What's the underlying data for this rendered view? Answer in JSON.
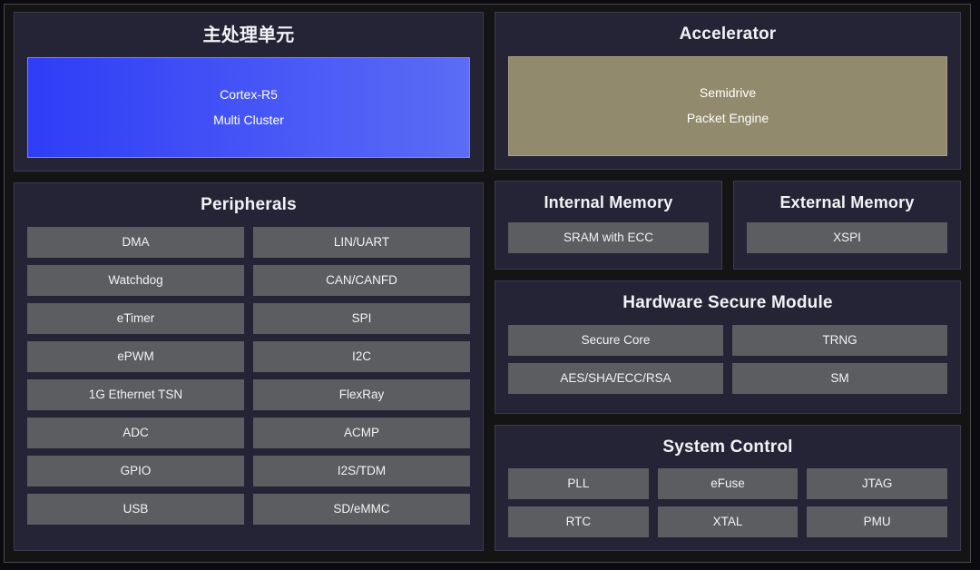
{
  "diagram": {
    "colors": {
      "page_background": "#141414",
      "panel_background": "#242436",
      "panel_border": "#3b3b52",
      "chip_background": "#5c5d60",
      "text": "#f2f2f5",
      "accent_blue_start": "#2f3df7",
      "accent_blue_end": "#5b6cf5",
      "accent_khaki": "#918a6c"
    },
    "left_column": {
      "main_processing_unit": {
        "title": "主处理单元",
        "block": {
          "line1": "Cortex-R5",
          "line2": "Multi Cluster"
        }
      },
      "peripherals": {
        "title": "Peripherals",
        "items": [
          "DMA",
          "LIN/UART",
          "Watchdog",
          "CAN/CANFD",
          "eTimer",
          "SPI",
          "ePWM",
          "I2C",
          "1G Ethernet TSN",
          "FlexRay",
          "ADC",
          "ACMP",
          "GPIO",
          "I2S/TDM",
          "USB",
          "SD/eMMC"
        ]
      }
    },
    "right_column": {
      "accelerator": {
        "title": "Accelerator",
        "block": {
          "line1": "Semidrive",
          "line2": "Packet Engine"
        }
      },
      "internal_memory": {
        "title": "Internal Memory",
        "items": [
          "SRAM with ECC"
        ]
      },
      "external_memory": {
        "title": "External Memory",
        "items": [
          "XSPI"
        ]
      },
      "hardware_secure_module": {
        "title": "Hardware Secure Module",
        "items": [
          "Secure Core",
          "TRNG",
          "AES/SHA/ECC/RSA",
          "SM"
        ]
      },
      "system_control": {
        "title": "System Control",
        "items": [
          "PLL",
          "eFuse",
          "JTAG",
          "RTC",
          "XTAL",
          "PMU"
        ]
      }
    }
  }
}
